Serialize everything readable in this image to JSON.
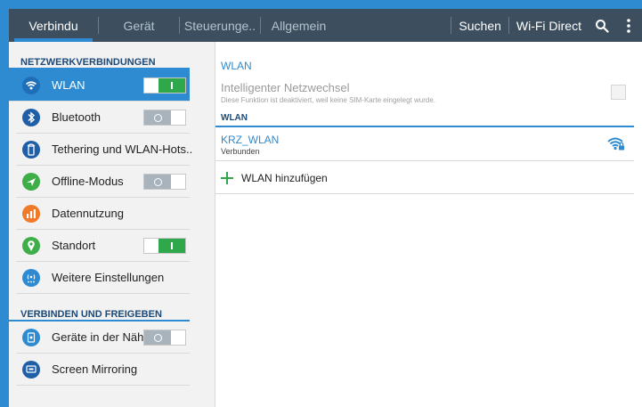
{
  "tabs": [
    {
      "label": "Verbindu",
      "active": true
    },
    {
      "label": "Gerät",
      "active": false
    },
    {
      "label": "Steuerunge..",
      "active": false
    },
    {
      "label": "Allgemein",
      "active": false
    }
  ],
  "actions": {
    "search_label": "Suchen",
    "wifi_direct_label": "Wi-Fi Direct"
  },
  "icons": {
    "search": "search-icon",
    "overflow": "overflow-menu-icon"
  },
  "colors": {
    "accent": "#2e8bd1",
    "actionbar": "#3d4f5f",
    "toggle_on": "#2ea84a",
    "toggle_off": "#a9b3bc"
  },
  "sidebar": {
    "section1_title": "NETZWERKVERBINDUNGEN",
    "section2_title": "VERBINDEN UND FREIGEBEN",
    "items": [
      {
        "label": "WLAN",
        "icon": "wifi-icon",
        "color": "#2e8bd1",
        "toggle": "on",
        "active": true
      },
      {
        "label": "Bluetooth",
        "icon": "bluetooth-icon",
        "color": "#1f5fa8",
        "toggle": "off"
      },
      {
        "label": "Tethering und WLAN-Hots..",
        "icon": "tethering-icon",
        "color": "#1f5fa8",
        "toggle": "none"
      },
      {
        "label": "Offline-Modus",
        "icon": "airplane-icon",
        "color": "#3fae49",
        "toggle": "off"
      },
      {
        "label": "Datennutzung",
        "icon": "data-usage-icon",
        "color": "#f07a2a",
        "toggle": "none"
      },
      {
        "label": "Standort",
        "icon": "location-icon",
        "color": "#3fae49",
        "toggle": "on"
      },
      {
        "label": "Weitere Einstellungen",
        "icon": "more-networks-icon",
        "color": "#2e8bd1",
        "toggle": "none"
      },
      {
        "label": "Geräte in der Näh..",
        "icon": "nearby-devices-icon",
        "color": "#2e8bd1",
        "toggle": "off"
      },
      {
        "label": "Screen Mirroring",
        "icon": "screen-mirroring-icon",
        "color": "#1f5fa8",
        "toggle": "none"
      }
    ]
  },
  "content": {
    "title": "WLAN",
    "smart_switch": {
      "title": "Intelligenter Netzwechsel",
      "description": "Diese Funktion ist deaktiviert, weil keine SIM-Karte eingelegt wurde.",
      "checked": false
    },
    "subheader": "WLAN",
    "network": {
      "name": "KRZ_WLAN",
      "status": "Verbunden",
      "icon": "wifi-locked-icon"
    },
    "add_label": "WLAN hinzufügen"
  }
}
